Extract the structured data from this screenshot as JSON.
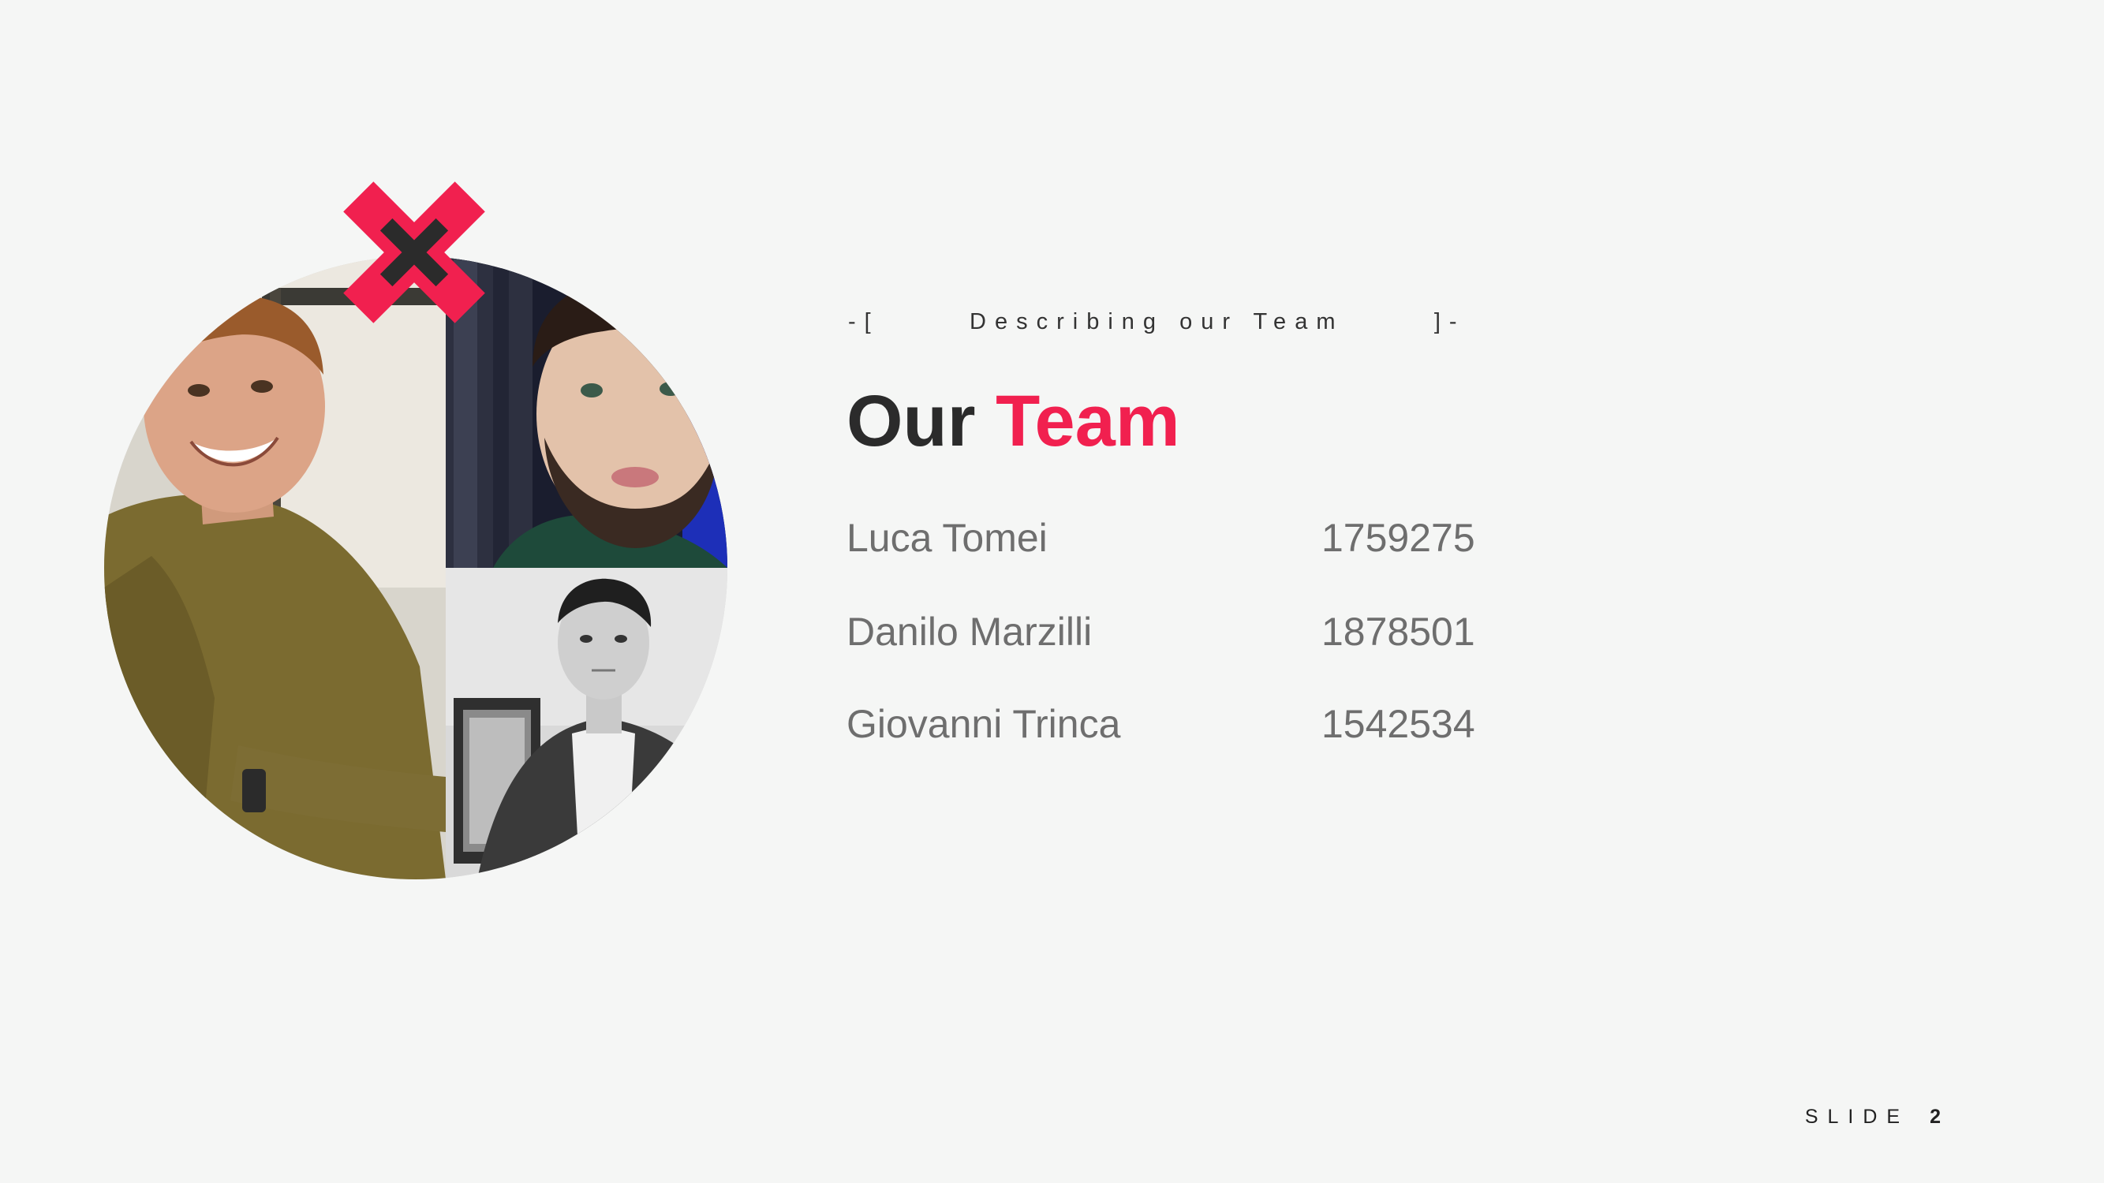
{
  "slide": {
    "kicker": "-[      Describing our Team      ]-",
    "title_part1": "Our ",
    "title_part2": "Team",
    "accent_color": "#f1204f",
    "members": [
      {
        "name": "Luca Tomei",
        "id": "1759275"
      },
      {
        "name": "Danilo Marzilli",
        "id": "1878501"
      },
      {
        "name": "Giovanni Trinca",
        "id": "1542534"
      }
    ],
    "footer_label": "SLIDE",
    "footer_number": "2"
  }
}
